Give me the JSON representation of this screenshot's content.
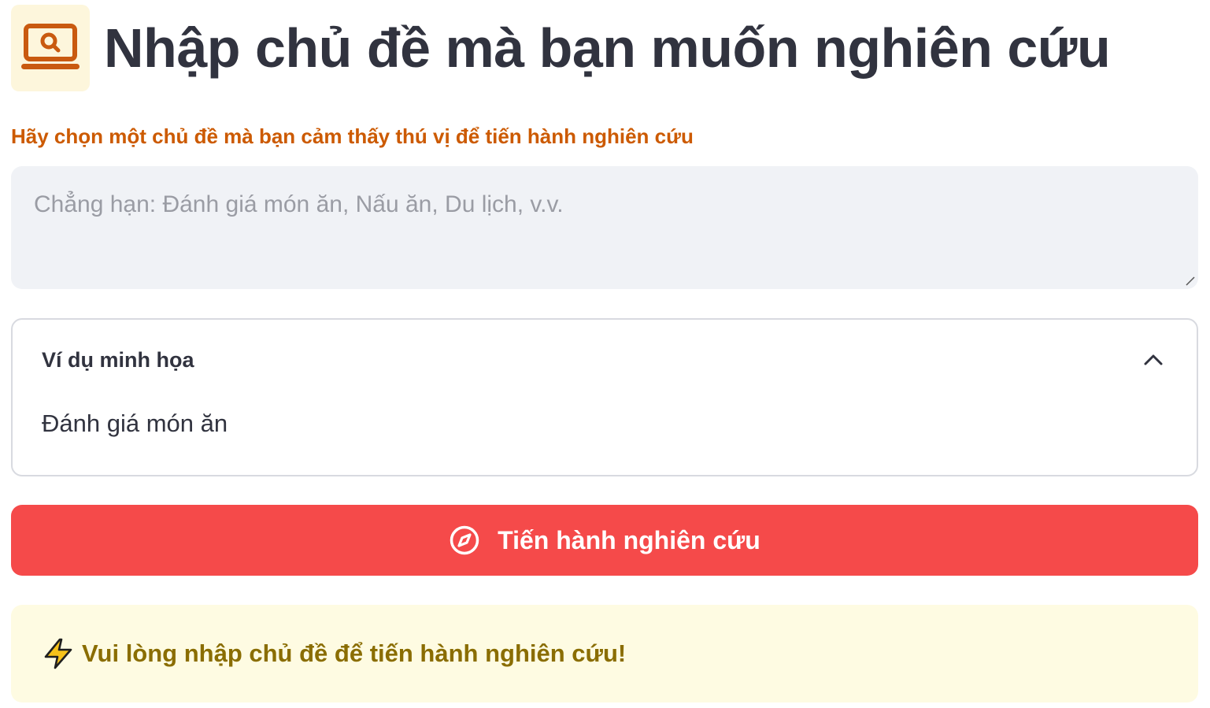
{
  "header": {
    "icon": "laptop-search-icon",
    "title": "Nhập chủ đề mà bạn muốn nghiên cứu"
  },
  "topic_field": {
    "label": "Hãy chọn một chủ đề mà bạn cảm thấy thú vị để tiến hành nghiên cứu",
    "value": "",
    "placeholder": "Chẳng hạn: Đánh giá món ăn, Nấu ăn, Du lịch, v.v."
  },
  "examples": {
    "title": "Ví dụ minh họa",
    "expanded": true,
    "items": [
      "Đánh giá món ăn"
    ]
  },
  "research_button": {
    "icon": "compass-icon",
    "label": "Tiến hành nghiên cứu"
  },
  "alert": {
    "icon": "lightning-icon",
    "message": "Vui lòng nhập chủ đề để tiến hành nghiên cứu!"
  },
  "colors": {
    "accent_orange": "#cc5a00",
    "button_red": "#f54a4a",
    "alert_bg": "#fefbe2",
    "alert_text": "#8a6d00",
    "input_bg": "#f0f2f6",
    "title_text": "#31333f"
  }
}
